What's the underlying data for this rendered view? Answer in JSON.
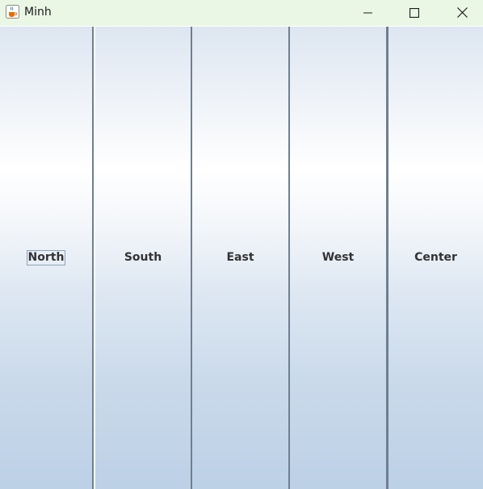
{
  "window": {
    "title": "Minh",
    "app_icon": "java-cup-icon",
    "controls": {
      "minimize_icon": "minimize-icon",
      "maximize_icon": "maximize-icon",
      "close_icon": "close-icon"
    },
    "titlebar_color": "#eaf7e5"
  },
  "buttons": [
    {
      "label": "North",
      "focused": true
    },
    {
      "label": "South",
      "focused": false
    },
    {
      "label": "East",
      "focused": false
    },
    {
      "label": "West",
      "focused": false
    },
    {
      "label": "Center",
      "focused": false
    }
  ]
}
